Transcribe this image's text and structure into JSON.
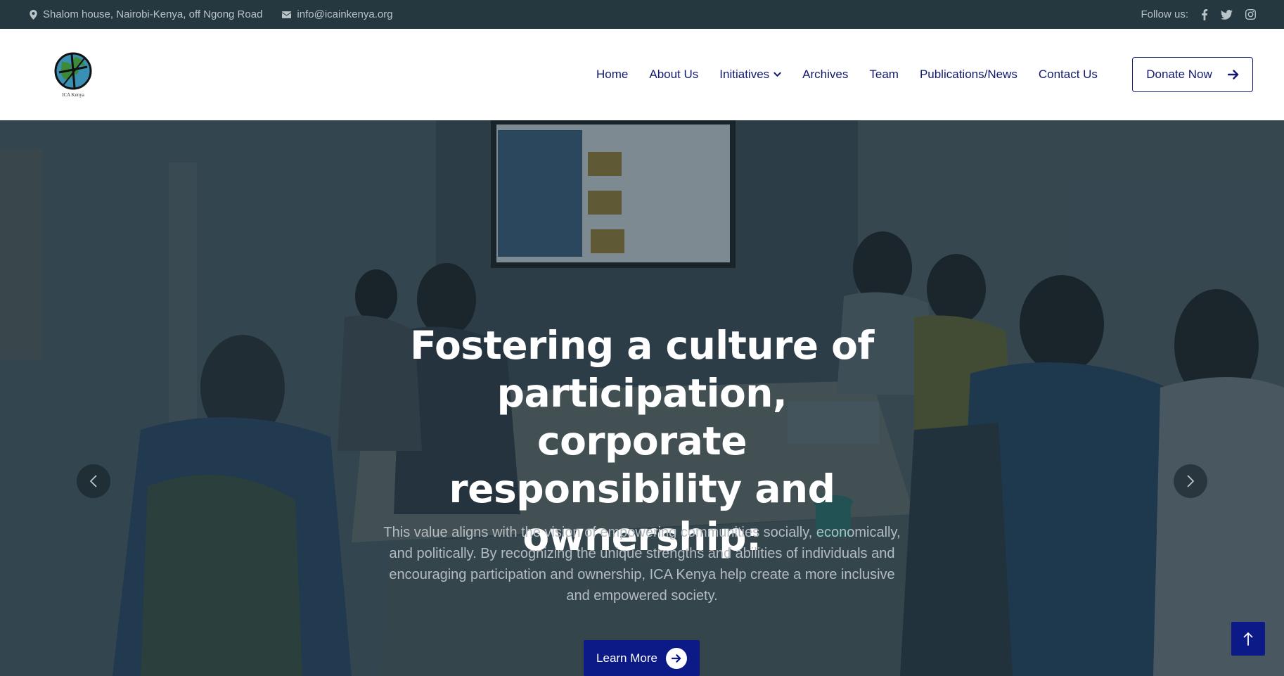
{
  "topbar": {
    "address": "Shalom house, Nairobi-Kenya, off Ngong Road",
    "email": "info@icainkenya.org",
    "follow_label": "Follow us:",
    "social": [
      "facebook-icon",
      "twitter-icon",
      "instagram-icon"
    ]
  },
  "header": {
    "logo_caption": "ICA Kenya",
    "nav": {
      "home": "Home",
      "about": "About Us",
      "initiatives": "Initiatives",
      "archives": "Archives",
      "team": "Team",
      "publications": "Publications/News",
      "contact": "Contact Us"
    },
    "donate_label": "Donate Now"
  },
  "hero": {
    "title": "Fostering a culture of participation, corporate responsibility and ownership:",
    "text": "This value aligns with the vision of empowering communities socially, economically, and politically. By recognizing the unique strengths and abilities of individuals and encouraging participation and ownership, ICA Kenya help create a more inclusive and empowered society.",
    "cta_label": "Learn More"
  },
  "colors": {
    "topbar_bg": "#26383f",
    "nav_text": "#13196e",
    "accent": "#0b1a86",
    "hero_text": "#b4bcc2"
  }
}
